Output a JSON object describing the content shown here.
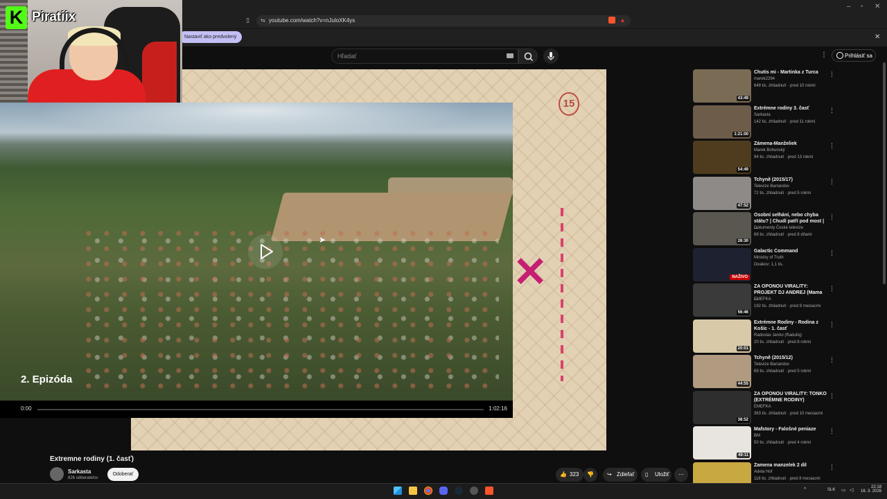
{
  "browser": {
    "url": "youtube.com/watch?v=nJuloXK4ys",
    "infobar_text": "Nastaviť ako predvolený"
  },
  "youtube": {
    "search_placeholder": "Hľadať",
    "signin_label": "Prihlásiť sa"
  },
  "stream": {
    "logo_letter": "K",
    "streamer_name": "Piratiix"
  },
  "overlay_player": {
    "episode_title": "2. Epizóda",
    "time_current": "0:00",
    "time_total": "1:02:16",
    "progress": 0
  },
  "background_video": {
    "badge_number": "15"
  },
  "video": {
    "title": "Extremne rodiny (1. časť)",
    "channel": "Sarkasta",
    "subscribers": "826 odberateľov",
    "subscribe_label": "Odoberať",
    "likes": "323",
    "share_label": "Zdieľať",
    "save_label": "Uložiť"
  },
  "recommendations": [
    {
      "title": "Chutis mi - Martinka z Turca",
      "channel": "marek2294",
      "meta": "648 tis. zhliadnutí · pred 10 rokmi",
      "duration": "43:49",
      "thumb": "#7a6b55"
    },
    {
      "title": "Extrémne rodiny 3. časť",
      "channel": "Sarkasta",
      "meta": "142 tis. zhliadnutí · pred 11 rokmi",
      "duration": "1:21:00",
      "thumb": "#6e5c4a"
    },
    {
      "title": "Zámena-Manželiek",
      "channel": "Marek Bohunský",
      "meta": "94 tis. zhliadnutí · pred 13 rokmi",
      "duration": "54:49",
      "thumb": "#4f3c1f"
    },
    {
      "title": "Tchyně (2015/17)",
      "channel": "Televize Barrandov",
      "meta": "72 tis. zhliadnutí · pred 5 rokmi",
      "duration": "47:52",
      "thumb": "#8e8a88"
    },
    {
      "title": "Osobní selhání, nebo chyba státu? | Chudí patří pod most | ...",
      "channel": "Dokumenty České televize",
      "meta": "69 tis. zhliadnutí · pred 8 dňami",
      "duration": "26:30",
      "thumb": "#5a5650"
    },
    {
      "title": "Galactic Command",
      "channel": "Ministry of Truth",
      "meta": "Divákov: 1,1 tis.",
      "duration": "NAŽIVO",
      "thumb": "#1e2230",
      "live": true
    },
    {
      "title": "ZA OPONOU VIRALITY: PROJEKT DJ ANDREJ (Mama ...",
      "channel": "EMEFKA",
      "meta": "192 tis. zhliadnutí · pred 8 mesiacmi",
      "duration": "56:46",
      "thumb": "#3a3a3a"
    },
    {
      "title": "Extrémne Rodiny - Rodina z Košíc - 1. časť",
      "channel": "Radoslav Jenko (Radulíq)",
      "meta": "20 tis. zhliadnutí · pred 8 rokmi",
      "duration": "20:01",
      "thumb": "#d8c9a8"
    },
    {
      "title": "Tchyně (2015/12)",
      "channel": "Televize Barrandov",
      "meta": "69 tis. zhliadnutí · pred 5 rokmi",
      "duration": "44:55",
      "thumb": "#b09a80"
    },
    {
      "title": "ZA OPONOU VIRALITY: TONKO (EXTRÉMNE RODINY)",
      "channel": "EMEFKA",
      "meta": "363 tis. zhliadnutí · pred 10 mesiacmi",
      "duration": "38:52",
      "thumb": "#2e2e2e"
    },
    {
      "title": "Mafstory - Falošné peniaze",
      "channel": "BM",
      "meta": "50 tis. zhliadnutí · pred 4 rokmi",
      "duration": "49:11",
      "thumb": "#e8e4e0"
    },
    {
      "title": "Zamena manzelek 2 dil",
      "channel": "Adela Hoř",
      "meta": "118 tis. zhliadnutí · pred 8 mesiacmi",
      "duration": "",
      "thumb": "#c8a840"
    }
  ],
  "taskbar": {
    "lang": "SLK",
    "time": "22:18",
    "date": "16. 3. 2026"
  }
}
